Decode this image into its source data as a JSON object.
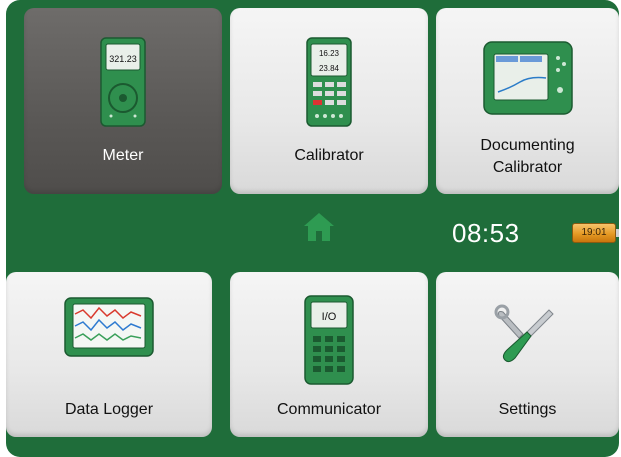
{
  "tiles": [
    {
      "label": "Meter",
      "icon": "meter-device-icon",
      "display_value": "321.23",
      "active": true
    },
    {
      "label": "Calibrator",
      "icon": "calibrator-device-icon",
      "display_values": [
        "16.23",
        "23.84"
      ]
    },
    {
      "label_line1": "Documenting",
      "label_line2": "Calibrator",
      "icon": "documenting-calibrator-device-icon"
    },
    {
      "label": "Data Logger",
      "icon": "data-logger-device-icon"
    },
    {
      "label": "Communicator",
      "icon": "communicator-device-icon",
      "display_value": "I/O"
    },
    {
      "label": "Settings",
      "icon": "wrench-screwdriver-icon"
    }
  ],
  "status": {
    "time": "08:53",
    "battery_label": "19:01",
    "home_icon": "home-icon"
  },
  "colors": {
    "background_green": "#1f6d3a",
    "device_green": "#2f8f4e",
    "active_tile": "#5a5856",
    "battery_orange": "#e59a24"
  }
}
